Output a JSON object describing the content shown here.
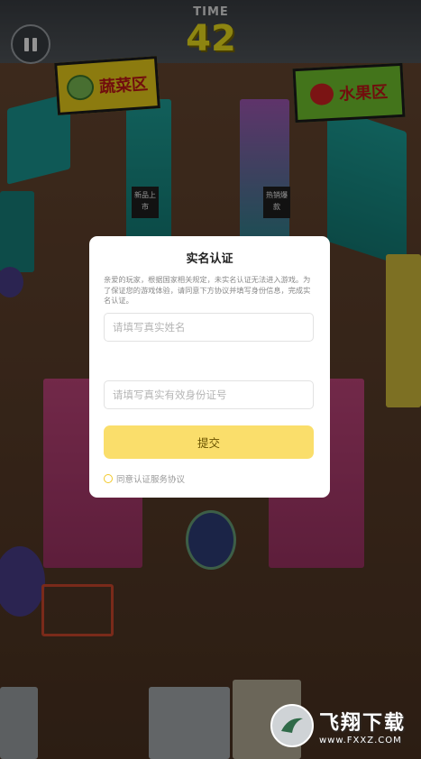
{
  "hud": {
    "timer_label": "TIME",
    "timer_value": "42",
    "pause_icon": "pause-icon"
  },
  "signs": {
    "vegetable": "蔬菜区",
    "fruit": "水果区",
    "new_arrival": "新品上市",
    "hot_sale": "热销爆款"
  },
  "dialog": {
    "title": "实名认证",
    "description": "亲爱的玩家，根据国家相关规定，未实名认证无法进入游戏。为了保证您的游戏体验，请同意下方协议并填写身份信息，完成实名认证。",
    "name_placeholder": "请填写真实姓名",
    "id_placeholder": "请填写真实有效身份证号",
    "submit_label": "提交",
    "agreement_label": "同意认证服务协议"
  },
  "watermark": {
    "title": "飞翔下载",
    "url": "www.FXXZ.COM"
  },
  "colors": {
    "timer": "#f3e61e",
    "submit_button": "#fade6b",
    "vegetable_sign": "#f2d51a",
    "fruit_sign": "#74c830",
    "sign_text": "#c31818"
  }
}
